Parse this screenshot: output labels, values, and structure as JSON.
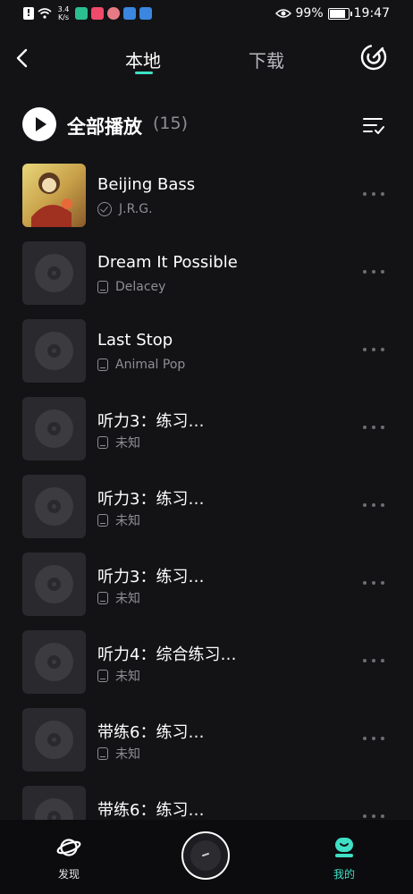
{
  "status_bar": {
    "net_speed_value": "3.4",
    "net_speed_unit": "K/s",
    "battery": "99%",
    "time": "19:47"
  },
  "header": {
    "tab_local": "本地",
    "tab_download": "下载"
  },
  "play_all": {
    "label": "全部播放",
    "count": "(15)"
  },
  "songs": [
    {
      "title": "Beijing Bass",
      "artist": "J.R.G.",
      "icon": "check-circle-icon"
    },
    {
      "title": "Dream It Possible",
      "artist": "Delacey",
      "icon": "device-icon"
    },
    {
      "title": "Last Stop",
      "artist": "Animal Pop",
      "icon": "device-icon"
    },
    {
      "title": "听力3：练习…",
      "artist": "未知",
      "icon": "device-icon"
    },
    {
      "title": "听力3：练习…",
      "artist": "未知",
      "icon": "device-icon"
    },
    {
      "title": "听力3：练习…",
      "artist": "未知",
      "icon": "device-icon"
    },
    {
      "title": "听力4：综合练习…",
      "artist": "未知",
      "icon": "device-icon"
    },
    {
      "title": "带练6：练习…",
      "artist": "未知",
      "icon": "device-icon"
    },
    {
      "title": "带练6：练习…",
      "artist": "",
      "icon": "device-icon"
    }
  ],
  "bottom_nav": {
    "discover": "发现",
    "mine": "我的"
  },
  "colors": {
    "accent": "#3fe0c5",
    "background": "#131316"
  }
}
